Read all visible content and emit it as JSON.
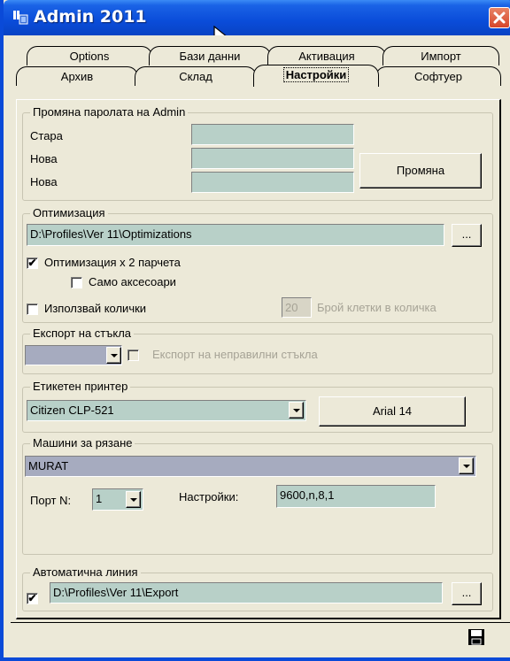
{
  "window": {
    "title": "Admin 2011"
  },
  "tabs_row1": [
    "Options",
    "Бази данни",
    "Активация",
    "Импорт"
  ],
  "tabs_row2": [
    "Архив",
    "Склад",
    "Настройки",
    "Софтуер"
  ],
  "active_tab": "Настройки",
  "password_group": {
    "legend": "Промяна паролата на Admin",
    "old_label": "Стара",
    "new_label": "Нова",
    "new2_label": "Нова",
    "old_value": "",
    "new_value": "",
    "new2_value": "",
    "change_button": "Промяна"
  },
  "optimization_group": {
    "legend": "Оптимизация",
    "path": "D:\\Profiles\\Ver 11\\Optimizations",
    "browse_button": "...",
    "x2_label": "Оптимизация х 2 парчета",
    "x2_checked": true,
    "accessories_label": "Само аксесоари",
    "accessories_checked": false,
    "carts_label": "Използвай колички",
    "carts_checked": false,
    "cells_value": "20",
    "cells_label": "Брой клетки в количка"
  },
  "export_group": {
    "legend": "Експорт на стъкла",
    "select_value": "",
    "invalid_label": "Експорт на неправилни стъкла",
    "invalid_checked": false
  },
  "printer_group": {
    "legend": "Етикетен принтер",
    "printer_value": "Citizen CLP-521",
    "font_button": "Arial 14"
  },
  "machines_group": {
    "legend": "Машини за рязане",
    "machine_value": "MURAT",
    "port_label": "Порт N:",
    "port_value": "1",
    "settings_label": "Настройки:",
    "settings_value": "9600,n,8,1"
  },
  "autoline_group": {
    "legend": "Автоматична линия",
    "enabled": true,
    "path": "D:\\Profiles\\Ver 11\\Export",
    "browse_button": "..."
  },
  "icons": {
    "app": "app-icon",
    "close": "close-icon",
    "save": "save-icon",
    "cursor": "mouse-cursor-icon"
  },
  "colors": {
    "titlebar": "#0a4cd9",
    "field": "#b8d0c8",
    "face": "#ece9d8"
  }
}
